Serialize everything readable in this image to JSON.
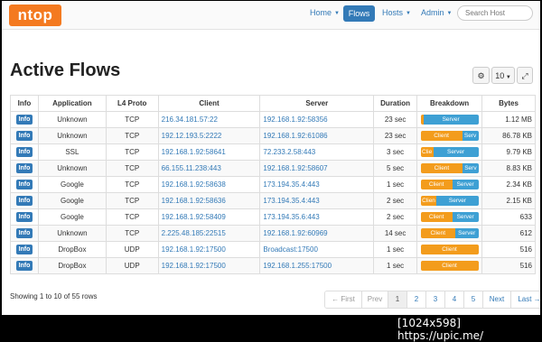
{
  "navbar": {
    "logo": "ntop",
    "items": [
      {
        "label": "Home"
      },
      {
        "label": "Flows"
      },
      {
        "label": "Hosts"
      },
      {
        "label": "Admin"
      }
    ],
    "search_placeholder": "Search Host"
  },
  "page": {
    "title": "Active Flows",
    "per_page": "10",
    "gear_icon": "gear-icon",
    "expand_icon": "expand-icon"
  },
  "table": {
    "headers": [
      "Info",
      "Application",
      "L4 Proto",
      "Client",
      "Server",
      "Duration",
      "Breakdown",
      "Bytes"
    ],
    "rows": [
      {
        "info": "Info",
        "application": "Unknown",
        "proto": "TCP",
        "client": "216.34.181.57:22",
        "server": "192.168.1.92:58356",
        "duration": "23 sec",
        "client_pct": 0.05,
        "breakdown_client": "",
        "breakdown_server": "Server",
        "bytes": "1.12 MB"
      },
      {
        "info": "Info",
        "application": "Unknown",
        "proto": "TCP",
        "client": "192.12.193.5:2222",
        "server": "192.168.1.92:61086",
        "duration": "23 sec",
        "client_pct": 0.72,
        "breakdown_client": "Client",
        "breakdown_server": "Serv",
        "bytes": "86.78 KB"
      },
      {
        "info": "Info",
        "application": "SSL",
        "proto": "TCP",
        "client": "192.168.1.92:58641",
        "server": "72.233.2.58:443",
        "duration": "3 sec",
        "client_pct": 0.22,
        "breakdown_client": "Clie",
        "breakdown_server": "Server",
        "bytes": "9.79 KB"
      },
      {
        "info": "Info",
        "application": "Unknown",
        "proto": "TCP",
        "client": "66.155.11.238:443",
        "server": "192.168.1.92:58607",
        "duration": "5 sec",
        "client_pct": 0.73,
        "breakdown_client": "Client",
        "breakdown_server": "Serv",
        "bytes": "8.83 KB"
      },
      {
        "info": "Info",
        "application": "Google",
        "proto": "TCP",
        "client": "192.168.1.92:58638",
        "server": "173.194.35.4:443",
        "duration": "1 sec",
        "client_pct": 0.55,
        "breakdown_client": "Client",
        "breakdown_server": "Server",
        "bytes": "2.34 KB"
      },
      {
        "info": "Info",
        "application": "Google",
        "proto": "TCP",
        "client": "192.168.1.92:58636",
        "server": "173.194.35.4:443",
        "duration": "2 sec",
        "client_pct": 0.28,
        "breakdown_client": "Clien",
        "breakdown_server": "Server",
        "bytes": "2.15 KB"
      },
      {
        "info": "Info",
        "application": "Google",
        "proto": "TCP",
        "client": "192.168.1.92:58409",
        "server": "173.194.35.6:443",
        "duration": "2 sec",
        "client_pct": 0.55,
        "breakdown_client": "Client",
        "breakdown_server": "Server",
        "bytes": "633"
      },
      {
        "info": "Info",
        "application": "Unknown",
        "proto": "TCP",
        "client": "2.225.48.185:22515",
        "server": "192.168.1.92:60969",
        "duration": "14 sec",
        "client_pct": 0.6,
        "breakdown_client": "Client",
        "breakdown_server": "Server",
        "bytes": "612"
      },
      {
        "info": "Info",
        "application": "DropBox",
        "proto": "UDP",
        "client": "192.168.1.92:17500",
        "server": "Broadcast:17500",
        "duration": "1 sec",
        "client_pct": 1.0,
        "breakdown_client": "Client",
        "breakdown_server": "",
        "bytes": "516"
      },
      {
        "info": "Info",
        "application": "DropBox",
        "proto": "UDP",
        "client": "192.168.1.92:17500",
        "server": "192.168.1.255:17500",
        "duration": "1 sec",
        "client_pct": 1.0,
        "breakdown_client": "Client",
        "breakdown_server": "",
        "bytes": "516"
      }
    ]
  },
  "footer": {
    "showing": "Showing 1 to 10 of 55 rows"
  },
  "pagination": [
    {
      "label": "← First",
      "state": "disabled"
    },
    {
      "label": "Prev",
      "state": "disabled"
    },
    {
      "label": "1",
      "state": "active"
    },
    {
      "label": "2",
      "state": "normal"
    },
    {
      "label": "3",
      "state": "normal"
    },
    {
      "label": "4",
      "state": "normal"
    },
    {
      "label": "5",
      "state": "normal"
    },
    {
      "label": "Next",
      "state": "normal"
    },
    {
      "label": "Last →",
      "state": "normal"
    }
  ],
  "watermark": "[1024x598] https://upic.me/",
  "colors": {
    "brand": "#f47a20",
    "accent": "#337ab7",
    "client_bar": "#f39c1c",
    "server_bar": "#3ea0d4"
  }
}
